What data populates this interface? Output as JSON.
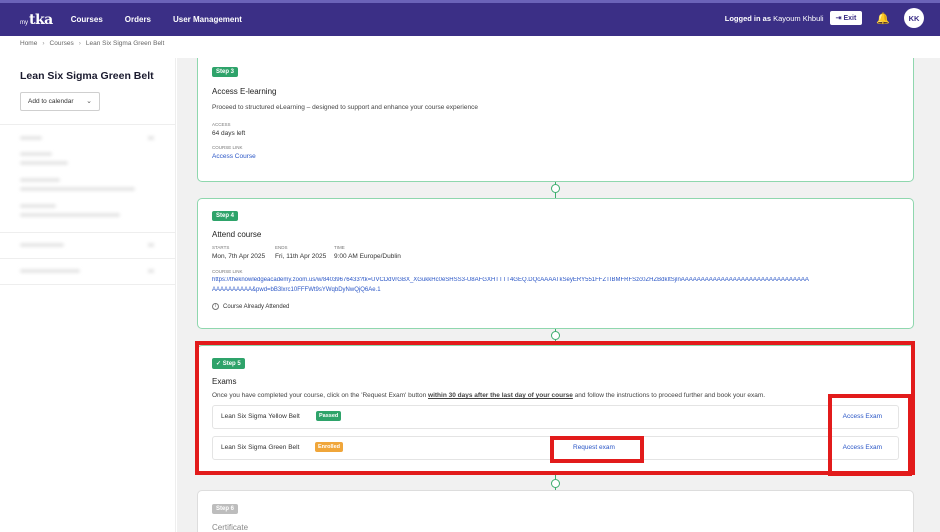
{
  "app": {
    "logo_small": "my",
    "logo_main": "tka",
    "nav": [
      "Courses",
      "Orders",
      "User Management"
    ],
    "logged_prefix": "Logged in as",
    "user_name": "Kayoum Khbuli",
    "exit_label": "Exit",
    "avatar_initials": "KK"
  },
  "breadcrumb": [
    "Home",
    "Courses",
    "Lean Six Sigma Green Belt"
  ],
  "sidebar": {
    "title": "Lean Six Sigma Green Belt",
    "add_calendar_label": "Add to calendar"
  },
  "steps": {
    "step3": {
      "badge": "Step 3",
      "title": "Access E-learning",
      "desc": "Proceed to structured eLearning – designed to support and enhance your course experience",
      "access_label": "ACCESS",
      "access_value": "64 days left",
      "course_link_label": "COURSE LINK",
      "course_link_value": "Access Course"
    },
    "step4": {
      "badge": "Step 4",
      "title": "Attend course",
      "starts_label": "STARTS",
      "starts_value": "Mon, 7th Apr 2025",
      "ends_label": "ENDS",
      "ends_value": "Fri, 11th Apr 2025",
      "time_label": "TIME",
      "time_value": "9:00 AM Europe/Dublin",
      "course_link_label": "COURSE LINK",
      "link_line1": "https://theknowledgeacademy.zoom.us/w/84039676433?tk=UVCDdVrGBX_XGukkHc0eSHSS3-U8AFGXHTTTT4GEQ.DQcAAAATkSeyERY551FFZTIBMFRFSzc0ZHZBdkItSjlnAAAAAAAAAAAAAAAAAAAAAAAAAAAAAAAA",
      "link_line2": "AAAAAAAAAA&pwd=bB3lxrc10FFFWt9sYWqbDyNwQjQ6Ae.1",
      "attended_label": "Course Already Attended"
    },
    "step5": {
      "badge": "✓ Step 5",
      "title": "Exams",
      "desc_pre": "Once you have completed your course, click on the 'Request Exam' button ",
      "desc_bold": "within 30 days after the last day of your course",
      "desc_post": " and follow the instructions to proceed further and book your exam.",
      "exams": [
        {
          "name": "Lean Six Sigma Yellow Belt",
          "status": "Passed",
          "action": "Access Exam"
        },
        {
          "name": "Lean Six Sigma Green Belt",
          "status": "Enrolled",
          "request": "Request exam",
          "action": "Access Exam"
        }
      ]
    },
    "step6": {
      "badge": "Step 6",
      "title": "Certificate"
    }
  },
  "colors": {
    "topbar": "#3b2f86",
    "step_green": "#2ea36a",
    "link_blue": "#2a56c6",
    "annotation_red": "#e21b1b",
    "enrolled_orange": "#f0a63a"
  }
}
